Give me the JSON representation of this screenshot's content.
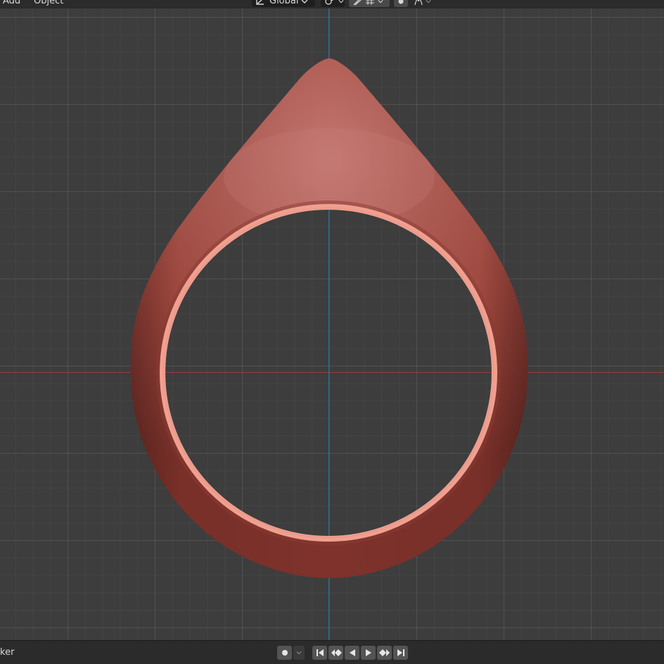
{
  "header": {
    "menu": [
      {
        "label": "Add"
      },
      {
        "label": "Object"
      }
    ],
    "transform_orientation": "Global"
  },
  "timeline": {
    "editor_label": "ker"
  },
  "colors": {
    "viewport_bg": "#3d3d3d",
    "x_axis": "#9a3a40",
    "y_axis": "#2f6d9c",
    "ring": "#b04a42"
  },
  "icons": [
    "transform-orientation-icon",
    "chevron-down-icon",
    "pivot-icon",
    "snap-icon",
    "snap-grid-icon",
    "proportional-edit-icon",
    "falloff-icon",
    "record-icon",
    "jump-start-icon",
    "prev-keyframe-icon",
    "play-reverse-icon",
    "play-icon",
    "next-keyframe-icon",
    "jump-end-icon"
  ]
}
